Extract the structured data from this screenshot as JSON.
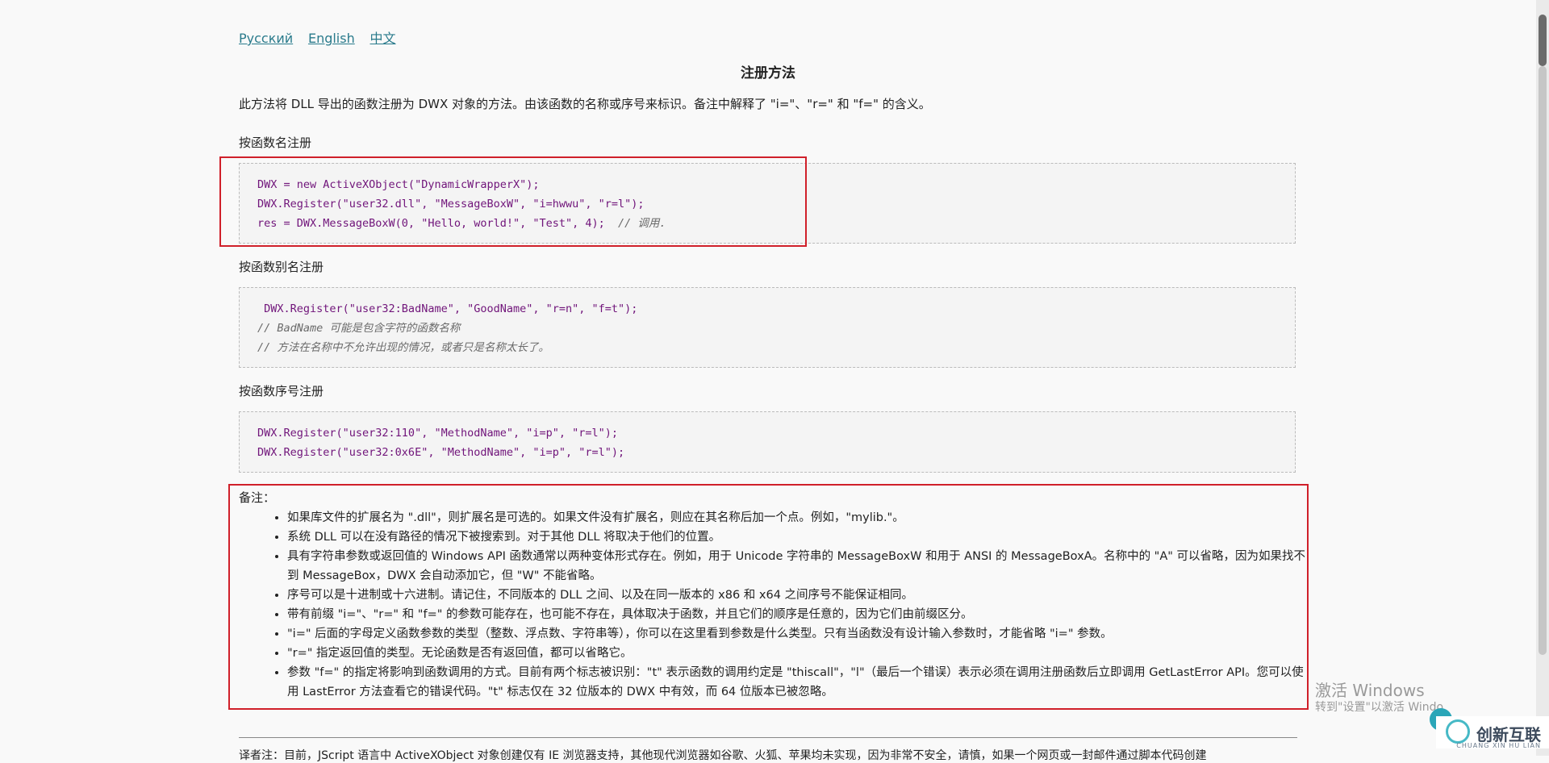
{
  "languages": [
    "Русский",
    "English",
    "中文"
  ],
  "title": "注册方法",
  "intro": "此方法将 DLL 导出的函数注册为 DWX 对象的方法。由该函数的名称或序号来标识。备注中解释了 \"i=\"、\"r=\" 和 \"f=\" 的含义。",
  "sections": [
    {
      "heading": "按函数名注册",
      "lines": [
        {
          "code": "DWX = new ActiveXObject(\"DynamicWrapperX\");",
          "comment": ""
        },
        {
          "code": "DWX.Register(\"user32.dll\", \"MessageBoxW\", \"i=hwwu\", \"r=l\");",
          "comment": ""
        },
        {
          "code": "res = DWX.MessageBoxW(0, \"Hello, world!\", \"Test\", 4);  ",
          "comment": "// 调用."
        }
      ]
    },
    {
      "heading": "按函数别名注册",
      "lines": [
        {
          "code": " DWX.Register(\"user32:BadName\", \"GoodName\", \"r=n\", \"f=t\");",
          "comment": ""
        },
        {
          "code": "",
          "comment": "// BadName 可能是包含字符的函数名称"
        },
        {
          "code": "",
          "comment": "// 方法在名称中不允许出现的情况，或者只是名称太长了。"
        }
      ]
    },
    {
      "heading": "按函数序号注册",
      "lines": [
        {
          "code": "DWX.Register(\"user32:110\", \"MethodName\", \"i=p\", \"r=l\");",
          "comment": ""
        },
        {
          "code": "DWX.Register(\"user32:0x6E\", \"MethodName\", \"i=p\", \"r=l\");",
          "comment": ""
        }
      ]
    }
  ],
  "notes_heading": "备注：",
  "notes": [
    "如果库文件的扩展名为 \".dll\"，则扩展名是可选的。如果文件没有扩展名，则应在其名称后加一个点。例如，\"mylib.\"。",
    "系统 DLL 可以在没有路径的情况下被搜索到。对于其他 DLL 将取决于他们的位置。",
    "具有字符串参数或返回值的 Windows API 函数通常以两种变体形式存在。例如，用于 Unicode 字符串的 MessageBoxW 和用于 ANSI 的 MessageBoxA。名称中的 \"A\" 可以省略，因为如果找不到 MessageBox，DWX 会自动添加它，但 \"W\" 不能省略。",
    "序号可以是十进制或十六进制。请记住，不同版本的 DLL 之间、以及在同一版本的 x86 和 x64 之间序号不能保证相同。",
    "带有前缀 \"i=\"、\"r=\" 和 \"f=\" 的参数可能存在，也可能不存在，具体取决于函数，并且它们的顺序是任意的，因为它们由前缀区分。",
    "\"i=\" 后面的字母定义函数参数的类型（整数、浮点数、字符串等），你可以在这里看到参数是什么类型。只有当函数没有设计输入参数时，才能省略 \"i=\" 参数。",
    "\"r=\" 指定返回值的类型。无论函数是否有返回值，都可以省略它。",
    "参数 \"f=\" 的指定将影响到函数调用的方式。目前有两个标志被识别：\"t\" 表示函数的调用约定是 \"thiscall\"，\"l\"（最后一个错误）表示必须在调用注册函数后立即调用 GetLastError API。您可以使用 LastError 方法查看它的错误代码。\"t\" 标志仅在 32 位版本的 DWX 中有效，而 64 位版本已被忽略。"
  ],
  "bottom_text": "译者注：目前，JScript 语言中 ActiveXObject 对象创建仅有 IE 浏览器支持，其他现代浏览器如谷歌、火狐、苹果均未实现，因为非常不安全，请慎，如果一个网页或一封邮件通过脚本代码创建",
  "watermark": {
    "line1": "激活 Windows",
    "line2": "转到\"设置\"以激活 Windo"
  },
  "brand": {
    "name": "创新互联",
    "sub": "CHUANG XIN HU LIAN"
  },
  "colors": {
    "link": "#2a7b8c",
    "code": "#70147a",
    "highlight_border": "#d0202a"
  }
}
